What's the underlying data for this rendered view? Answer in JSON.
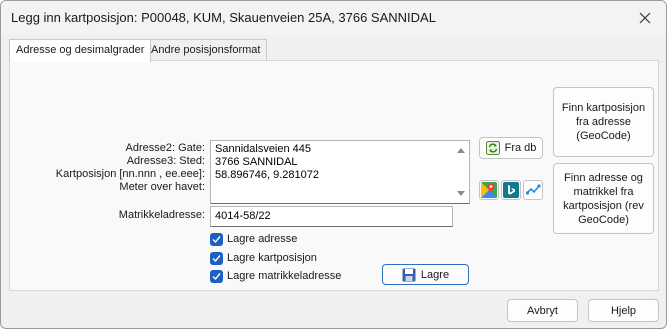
{
  "window": {
    "title": "Legg inn kartposisjon: P00048, KUM, Skauenveien 25A, 3766 SANNIDAL"
  },
  "tabs": [
    {
      "label": "Adresse og desimalgrader",
      "active": true
    },
    {
      "label": "Andre posisjonsformat",
      "active": false
    }
  ],
  "fields": {
    "labels": {
      "gate": "Adresse2: Gate:",
      "sted": "Adresse3: Sted:",
      "kartposisjon": "Kartposisjon [nn.nnn , ee.eee]:",
      "meter": "Meter over havet:",
      "matrikkel": "Matrikkeladresse:"
    },
    "address_lines": [
      "Sannidalsveien 445",
      "3766 SANNIDAL",
      "58.896746,  9.281072"
    ],
    "matrikkel_value": "4014-58/22"
  },
  "buttons": {
    "fra_db": "Fra db",
    "geocode": "Finn kartposisjon fra adresse (GeoCode)",
    "rev_geocode": "Finn adresse og matrikkel fra kartposisjon (rev GeoCode)",
    "lagre": "Lagre",
    "avbryt": "Avbryt",
    "hjelp": "Hjelp"
  },
  "checkboxes": [
    {
      "label": "Lagre adresse",
      "checked": true
    },
    {
      "label": "Lagre kartposisjon",
      "checked": true
    },
    {
      "label": "Lagre matrikkeladresse",
      "checked": true
    }
  ],
  "colors": {
    "accent": "#1f5fbf",
    "bing": "#0f7b8c"
  }
}
